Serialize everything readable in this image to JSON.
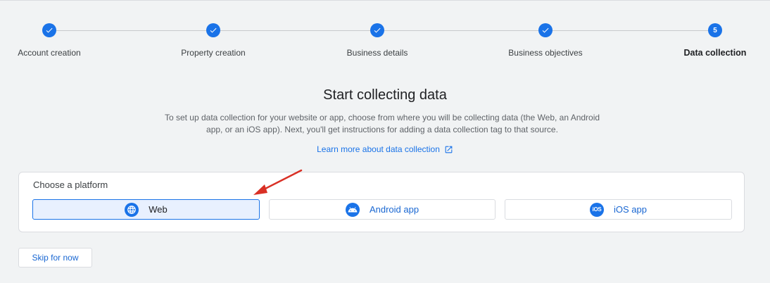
{
  "stepper": {
    "steps": [
      {
        "label": "Account creation",
        "state": "complete"
      },
      {
        "label": "Property creation",
        "state": "complete"
      },
      {
        "label": "Business details",
        "state": "complete"
      },
      {
        "label": "Business objectives",
        "state": "complete"
      },
      {
        "label": "Data collection",
        "state": "current",
        "number": "5"
      }
    ]
  },
  "main": {
    "title": "Start collecting data",
    "description": "To set up data collection for your website or app, choose from where you will be collecting data (the Web, an Android app, or an iOS app). Next, you'll get instructions for adding a data collection tag to that source.",
    "learn_more_label": "Learn more about data collection",
    "learn_more_icon": "external-link-icon"
  },
  "platform": {
    "heading": "Choose a platform",
    "options": [
      {
        "label": "Web",
        "icon": "globe-icon",
        "selected": true
      },
      {
        "label": "Android app",
        "icon": "android-icon",
        "selected": false
      },
      {
        "label": "iOS app",
        "icon": "ios-icon",
        "icon_text": "iOS",
        "selected": false
      }
    ]
  },
  "skip_label": "Skip for now",
  "colors": {
    "accent": "#1a73e8",
    "annotation_arrow": "#d93025",
    "selected_bg": "#e8f0fe"
  }
}
